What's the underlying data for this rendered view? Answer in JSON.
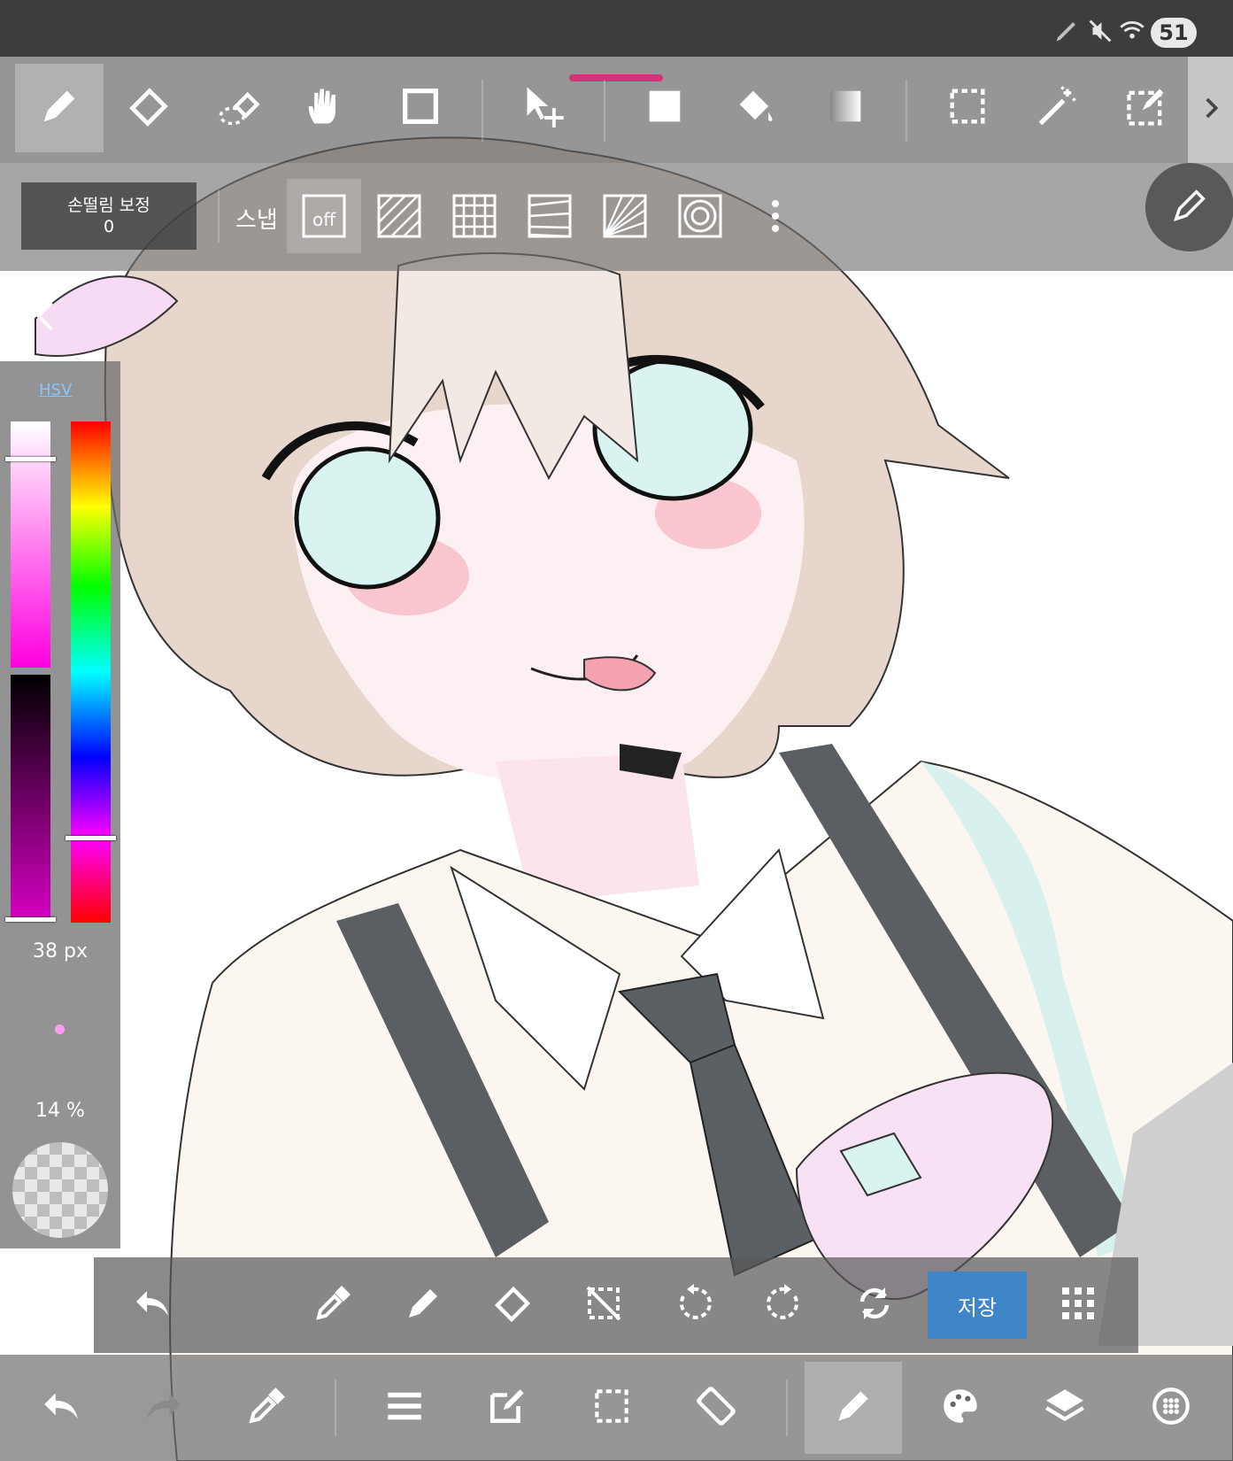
{
  "status_bar": {
    "icons": [
      "pen-icon",
      "mute-icon",
      "wifi-icon"
    ],
    "battery": "51"
  },
  "toolbar": {
    "tools": [
      {
        "name": "brush-tool",
        "icon": "pencil-icon",
        "active": true
      },
      {
        "name": "eraser-tool",
        "icon": "eraser-icon"
      },
      {
        "name": "blur-tool",
        "icon": "blur-eraser-icon"
      },
      {
        "name": "hand-tool",
        "icon": "hand-icon"
      },
      {
        "name": "shape-tool",
        "icon": "square-outline-icon"
      },
      {
        "name": "move-tool",
        "icon": "move-cursor-icon"
      },
      {
        "name": "fill-tool",
        "icon": "filled-square-icon"
      },
      {
        "name": "bucket-tool",
        "icon": "paint-bucket-icon"
      },
      {
        "name": "gradient-tool",
        "icon": "gradient-icon"
      },
      {
        "name": "select-tool",
        "icon": "dashed-rect-icon"
      },
      {
        "name": "magic-wand-tool",
        "icon": "magic-wand-icon"
      },
      {
        "name": "select-pen-tool",
        "icon": "select-pen-icon"
      }
    ],
    "more": "chevron-right-icon"
  },
  "brush_options": {
    "stabilizer_label": "손떨림 보정",
    "stabilizer_value": "0",
    "snap_label": "스냅",
    "snap_off_label": "off",
    "snaps": [
      "parallel-snap-icon",
      "grid-snap-icon",
      "perspective-snap-icon",
      "radial-snap-icon",
      "circle-snap-icon"
    ],
    "more": "vertical-dots-icon"
  },
  "color_panel": {
    "tab": "HSV",
    "saturation_value": 0.15,
    "hue_value": 0.83,
    "brush_size": "38 px",
    "opacity": "14 %",
    "color": "#ff9cf2"
  },
  "quick_bar": {
    "buttons": [
      "undo-icon",
      "eyedropper-icon",
      "pencil-icon",
      "eraser-icon",
      "deselect-icon",
      "rotate-left-icon",
      "rotate-right-icon",
      "flip-icon"
    ],
    "save_label": "저장",
    "grid": "grid-dots-icon"
  },
  "bottom_bar": {
    "buttons": [
      "undo-icon",
      "redo-icon",
      "eyedropper-icon",
      "menu-icon",
      "edit-icon",
      "selection-icon",
      "rotate-screen-icon",
      "brush-icon",
      "palette-icon",
      "layers-icon",
      "material-icon"
    ]
  },
  "colors": {
    "accent": "#d2327a",
    "save": "#3f86c8",
    "hsv_tab": "#7fc9ff"
  }
}
